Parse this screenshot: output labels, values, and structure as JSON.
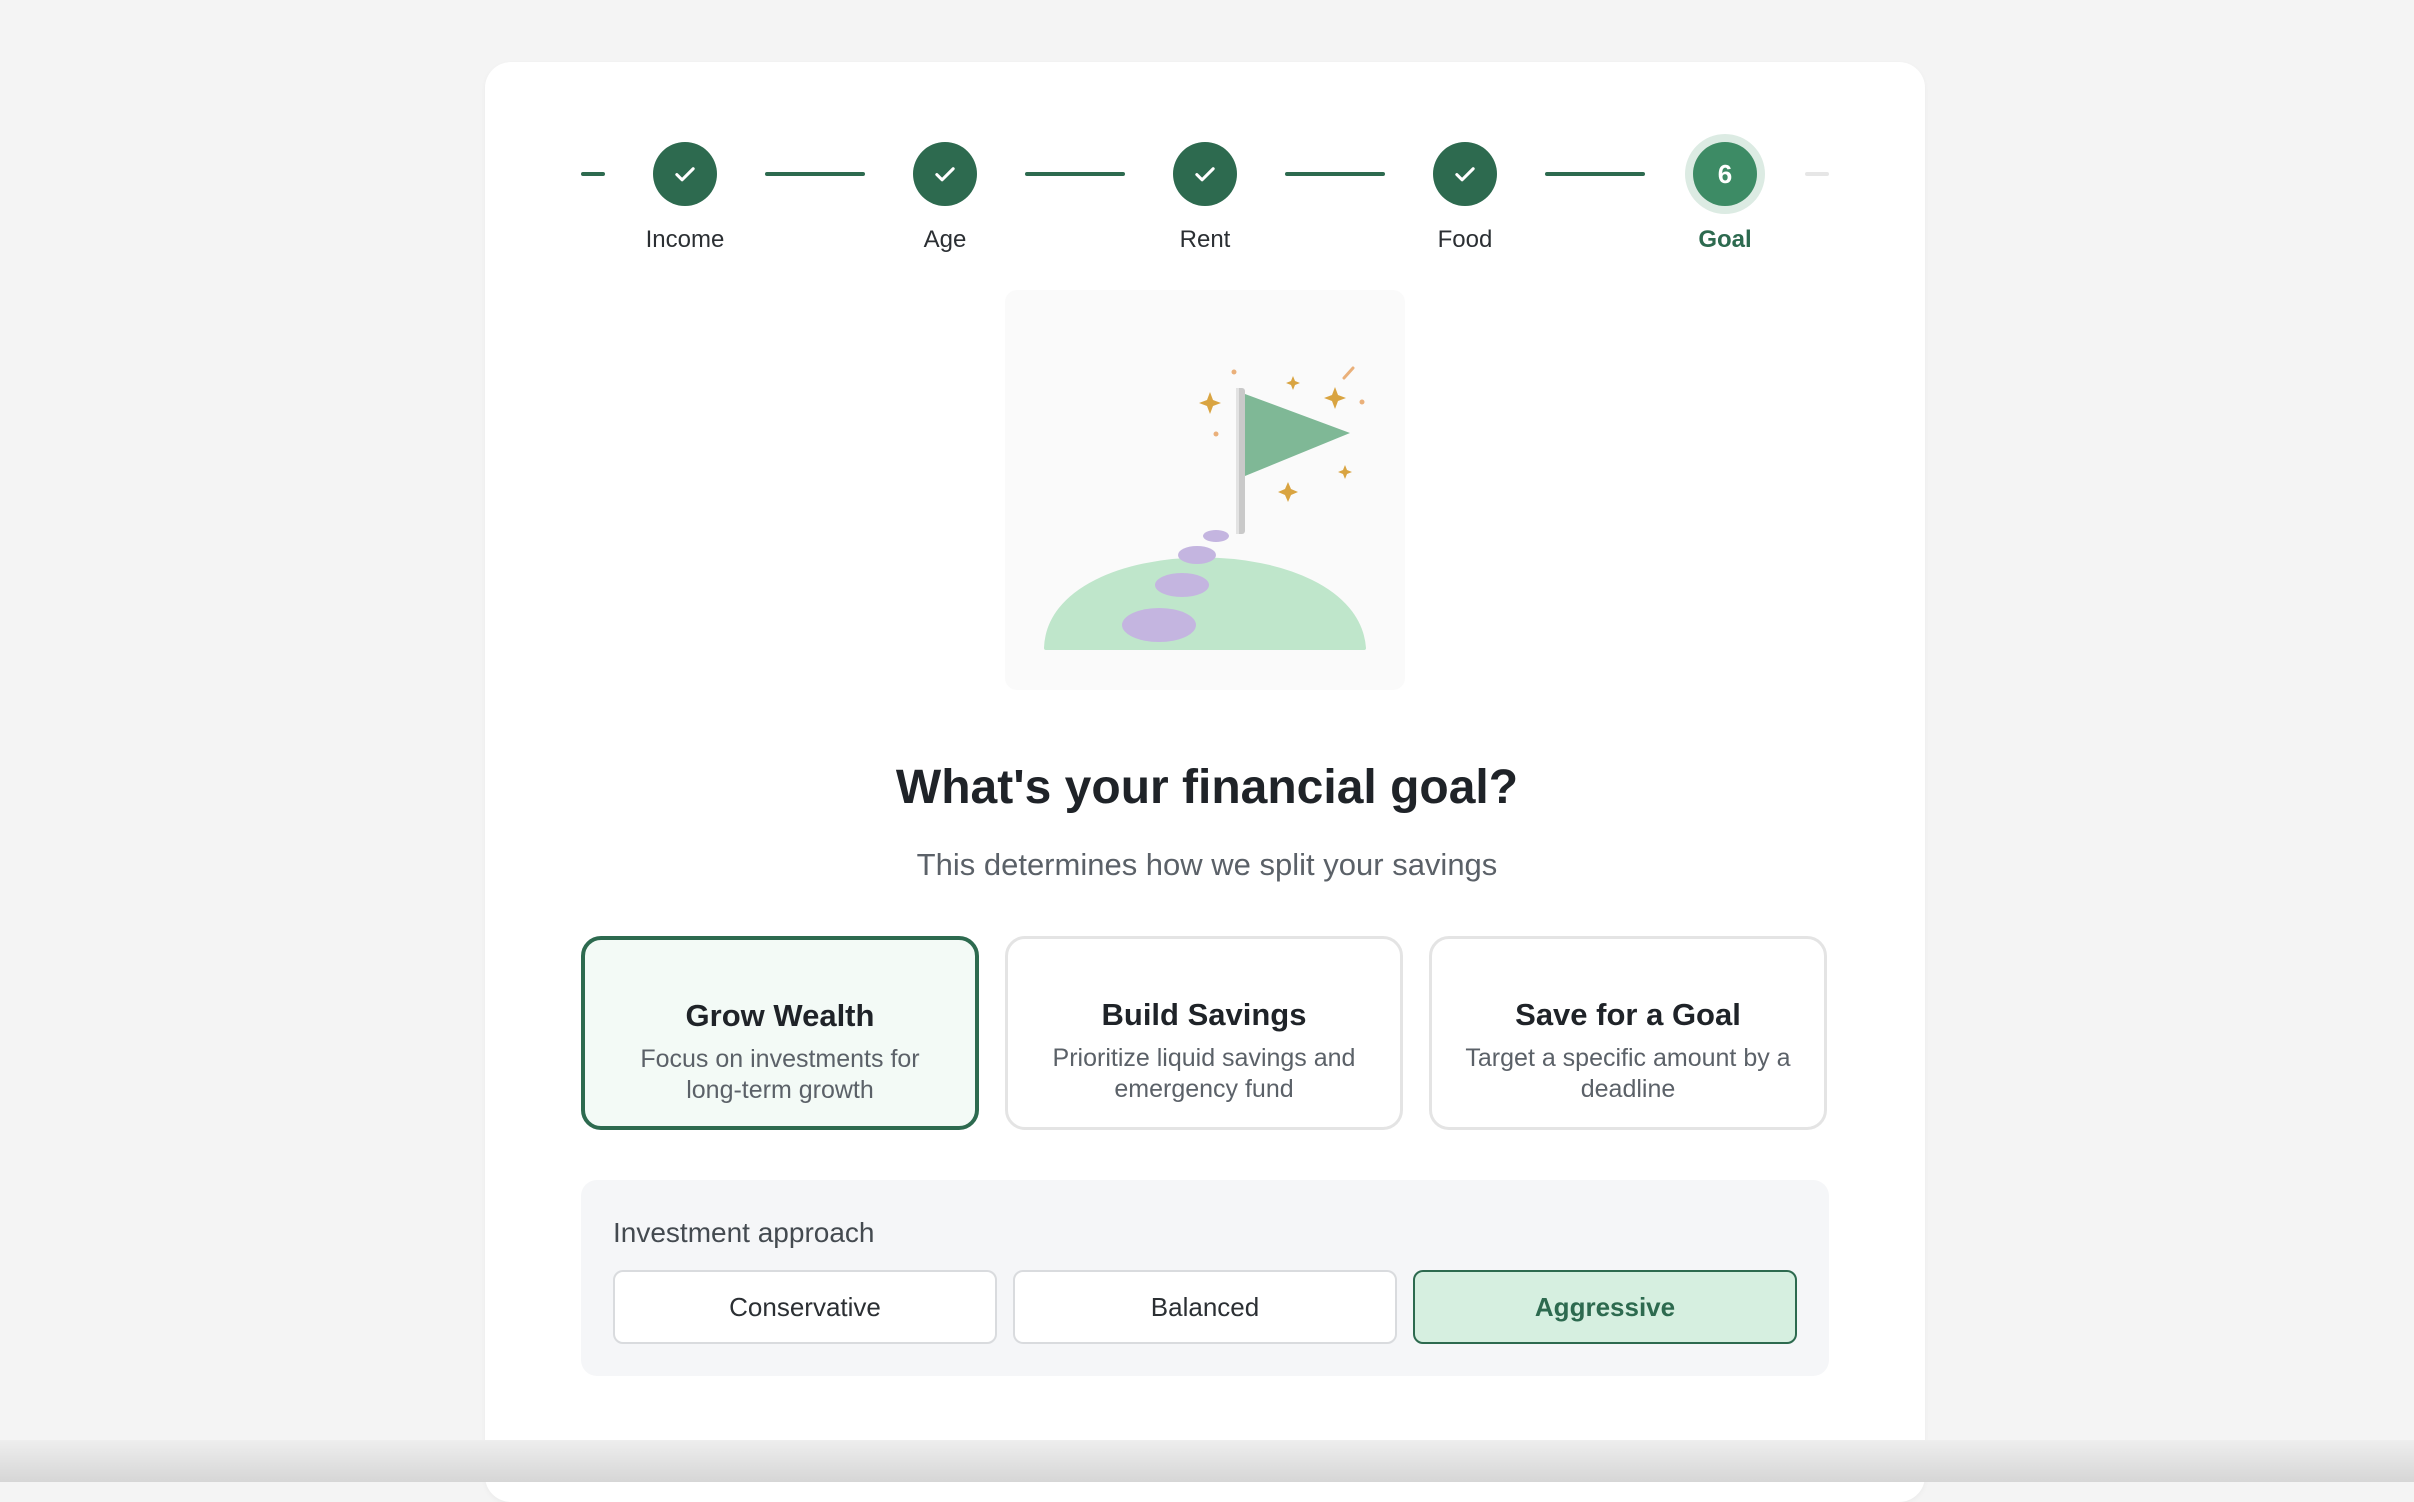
{
  "stepper": {
    "steps": [
      {
        "label": "Income",
        "status": "done",
        "icon": "check-icon"
      },
      {
        "label": "Age",
        "status": "done",
        "icon": "check-icon"
      },
      {
        "label": "Rent",
        "status": "done",
        "icon": "check-icon"
      },
      {
        "label": "Food",
        "status": "done",
        "icon": "check-icon"
      },
      {
        "label": "Goal",
        "status": "current",
        "number": "6"
      }
    ]
  },
  "illustration": {
    "icon": "goal-flag-hill-illustration"
  },
  "heading": {
    "title": "What's your financial goal?",
    "subtitle": "This determines how we split your savings"
  },
  "goals": [
    {
      "title": "Grow Wealth",
      "description": "Focus on investments for long-term growth",
      "selected": true
    },
    {
      "title": "Build Savings",
      "description": "Prioritize liquid savings and emergency fund",
      "selected": false
    },
    {
      "title": "Save for a Goal",
      "description": "Target a specific amount by a deadline",
      "selected": false
    }
  ],
  "investment": {
    "label": "Investment approach",
    "options": [
      {
        "label": "Conservative",
        "selected": false
      },
      {
        "label": "Balanced",
        "selected": false
      },
      {
        "label": "Aggressive",
        "selected": true
      }
    ]
  },
  "colors": {
    "accent": "#2d6a4f",
    "current_step": "#3d8b65",
    "selected_bg": "#f3faf6",
    "approach_selected_bg": "#d6efe0"
  }
}
